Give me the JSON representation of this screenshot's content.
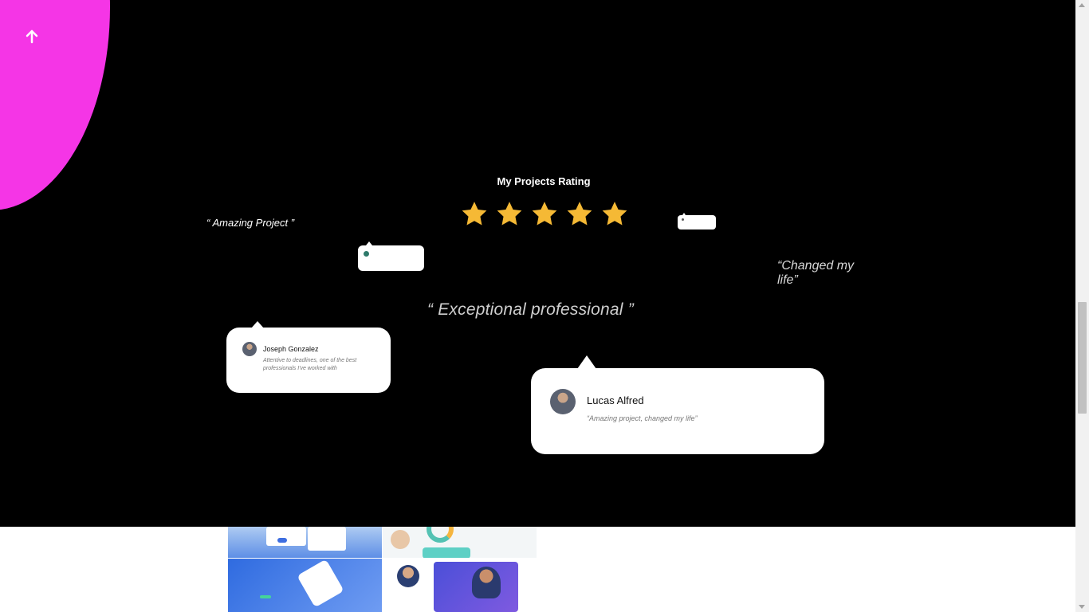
{
  "scroll_top": {
    "icon": "arrow-up-icon"
  },
  "rating": {
    "title": "My Projects Rating",
    "stars": 5,
    "star_color": "#f5b935"
  },
  "quotes": {
    "amazing": "“ Amazing Project ”",
    "changed": "“Changed my life”",
    "exceptional": "“ Exceptional professional ”"
  },
  "testimonials": [
    {
      "name": "Joseph Gonzalez",
      "text": "Attentive to deadlines, one of the best professionals I've worked with"
    },
    {
      "name": "Lucas Alfred",
      "text": "“Amazing project, changed my life”"
    }
  ],
  "colors": {
    "background": "#000000",
    "accent": "#f535e6",
    "bubble": "#ffffff"
  }
}
